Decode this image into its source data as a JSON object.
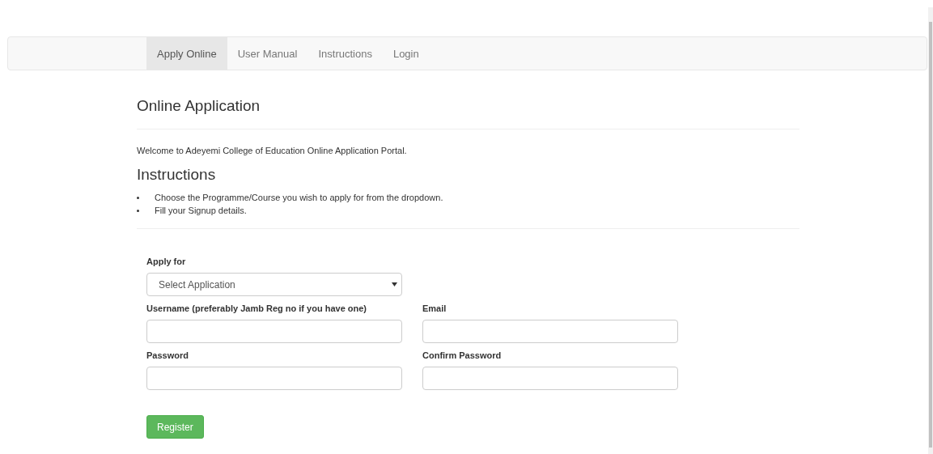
{
  "nav": [
    {
      "label": "Apply Online",
      "selected": true
    },
    {
      "label": "User Manual",
      "selected": false
    },
    {
      "label": "Instructions",
      "selected": false
    },
    {
      "label": "Login",
      "selected": false
    }
  ],
  "title": "Online Application",
  "welcome": "Welcome to Adeyemi College of Education Online Application Portal.",
  "instructions": {
    "heading": "Instructions",
    "items": [
      "Choose the Programme/Course you wish to apply for from the dropdown.",
      "Fill your Signup details."
    ]
  },
  "form": {
    "apply_for": {
      "label": "Apply for",
      "value": "Select Application"
    },
    "fields": [
      {
        "label": "Username (preferably Jamb Reg no if you have one)"
      },
      {
        "label": "Email"
      },
      {
        "label": "Password"
      },
      {
        "label": "Confirm Password"
      }
    ],
    "submit": "Register"
  }
}
